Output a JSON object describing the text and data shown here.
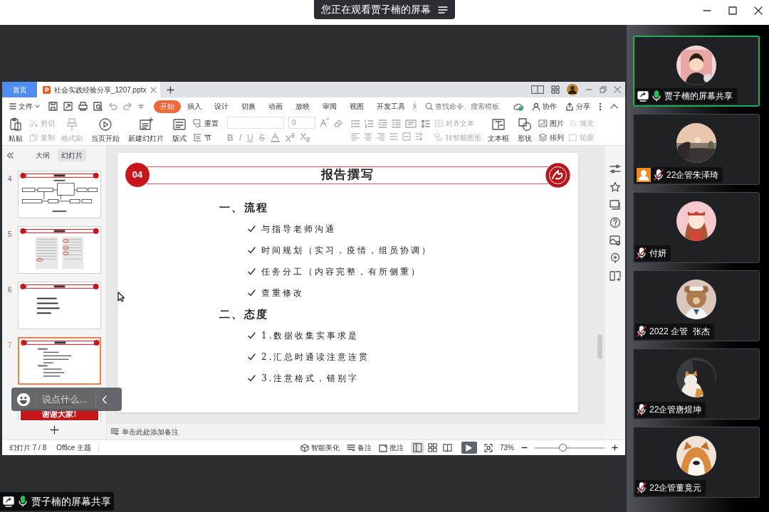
{
  "top_bar": {
    "title": "您正在观看贾子楠的屏幕"
  },
  "wps": {
    "tabs": [
      {
        "label": "首页",
        "kind": "home",
        "selected": false
      },
      {
        "label": "社会实践经验分享_1207.pptx",
        "kind": "document",
        "selected": true
      }
    ],
    "file_menu": "文件",
    "ribbon_tabs": [
      {
        "label": "开始",
        "selected": true
      },
      {
        "label": "插入",
        "selected": false
      },
      {
        "label": "设计",
        "selected": false
      },
      {
        "label": "切换",
        "selected": false
      },
      {
        "label": "动画",
        "selected": false
      },
      {
        "label": "放映",
        "selected": false
      },
      {
        "label": "审阅",
        "selected": false
      },
      {
        "label": "视图",
        "selected": false
      },
      {
        "label": "开发工具",
        "selected": false
      }
    ],
    "search": {
      "placeholder": "查找命令、搜索模板"
    },
    "actions": [
      "协作",
      "分享"
    ],
    "ribbon": [
      {
        "kind": "large",
        "items": [
          {
            "label": "粘贴",
            "disabled": false
          }
        ]
      },
      {
        "kind": "pair",
        "items": [
          {
            "label": "剪切",
            "disabled": true
          },
          {
            "label": "复制",
            "disabled": true
          }
        ]
      },
      {
        "kind": "large",
        "items": [
          {
            "label": "格式刷",
            "disabled": true
          }
        ]
      },
      {
        "kind": "large",
        "items": [
          {
            "label": "当页开始",
            "disabled": false
          }
        ]
      },
      {
        "kind": "large",
        "items": [
          {
            "label": "新建幻灯片",
            "disabled": false
          }
        ]
      },
      {
        "kind": "large",
        "items": [
          {
            "label": "版式",
            "disabled": false
          }
        ]
      },
      {
        "kind": "pair",
        "items": [
          {
            "label": "重置",
            "disabled": false
          },
          {
            "label": "节",
            "disabled": false
          }
        ]
      },
      {
        "kind": "font",
        "font_size": "0",
        "styles": [
          "B",
          "I",
          "U",
          "S"
        ]
      },
      {
        "kind": "paragraph"
      },
      {
        "kind": "pair",
        "items": [
          {
            "label": "对齐文本",
            "disabled": true
          },
          {
            "label": "转智能图形",
            "disabled": true
          }
        ]
      },
      {
        "kind": "large",
        "items": [
          {
            "label": "文本框",
            "disabled": false
          }
        ]
      },
      {
        "kind": "large",
        "items": [
          {
            "label": "形状",
            "disabled": false
          }
        ]
      },
      {
        "kind": "pair",
        "items": [
          {
            "label": "图片",
            "disabled": false
          },
          {
            "label": "排列",
            "disabled": false
          }
        ]
      },
      {
        "kind": "pair",
        "items": [
          {
            "label": "填充",
            "disabled": true
          },
          {
            "label": "轮廓",
            "disabled": true
          }
        ]
      }
    ],
    "panel_tabs": [
      {
        "label": "大纲",
        "selected": false
      },
      {
        "label": "幻灯片",
        "selected": true
      }
    ],
    "thumbnails": [
      {
        "number": "4",
        "kind": "flowchart",
        "selected": false
      },
      {
        "number": "5",
        "kind": "documents",
        "selected": false
      },
      {
        "number": "6",
        "kind": "bullets",
        "selected": false
      },
      {
        "number": "7",
        "kind": "outline",
        "selected": true
      },
      {
        "kind": "closing",
        "caption": "谢谢大家!",
        "selected": false
      }
    ],
    "slide": {
      "badge": "04",
      "title": "报告撰写",
      "sections": [
        {
          "heading": "一、流程",
          "items": [
            "与指导老师沟通",
            "时间规划（实习，疫情，组员协调）",
            "任务分工（内容完整，有所侧重）",
            "查重修改"
          ]
        },
        {
          "heading": "二、态度",
          "items": [
            "1.数据收集实事求是",
            "2.汇总时通读注意连贯",
            "3.注意格式，错别字"
          ]
        }
      ]
    },
    "notes": {
      "placeholder": "单击此处添加备注"
    },
    "status_bar": {
      "slide_position": "幻灯片 7 / 8",
      "theme": "Office 主题",
      "tools": [
        "智能美化",
        "备注",
        "批注"
      ],
      "views": [
        {
          "selected": true
        },
        {
          "selected": false
        },
        {
          "selected": false
        }
      ],
      "zoom": "73%",
      "zoom_slider": {
        "level": 0.4
      }
    }
  },
  "chat_input": {
    "placeholder": "说点什么..."
  },
  "share_badge": {
    "label": "贾子楠的屏幕共享",
    "muted": false
  },
  "participants": [
    {
      "name": "贾子楠的屏幕共享",
      "selected": true,
      "sharing": true,
      "host": false,
      "muted": false
    },
    {
      "name": "22企管朱泽琦",
      "selected": false,
      "sharing": false,
      "host": true,
      "muted": true
    },
    {
      "name": "付妍",
      "selected": false,
      "sharing": false,
      "host": false,
      "muted": true
    },
    {
      "name": "2022 企管  张杰",
      "selected": false,
      "sharing": false,
      "host": false,
      "muted": true
    },
    {
      "name": "22企管唐煜坤",
      "selected": false,
      "sharing": false,
      "host": false,
      "muted": true
    },
    {
      "name": "22企管董竟元",
      "selected": false,
      "sharing": false,
      "host": false,
      "muted": true
    }
  ]
}
